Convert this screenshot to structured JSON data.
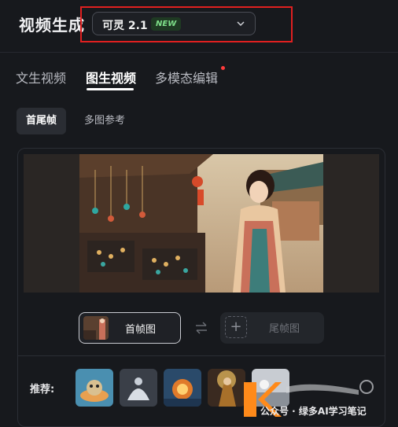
{
  "header": {
    "title": "视频生成",
    "model": {
      "name": "可灵 2.1",
      "badge": "NEW"
    }
  },
  "tabs": [
    {
      "label": "文生视频",
      "active": false
    },
    {
      "label": "图生视频",
      "active": true
    },
    {
      "label": "多模态编辑",
      "active": false,
      "dot": true
    }
  ],
  "subtabs": [
    {
      "label": "首尾帧",
      "active": true
    },
    {
      "label": "多图参考",
      "active": false
    }
  ],
  "frames": {
    "first_label": "首帧图",
    "last_label": "尾帧图",
    "plus": "+"
  },
  "recommend": {
    "label": "推荐:"
  },
  "watermark": {
    "text": "公众号 · 绿多AI学习笔记"
  },
  "colors": {
    "accent_red": "#e02020",
    "badge_green": "#7fe08a"
  }
}
